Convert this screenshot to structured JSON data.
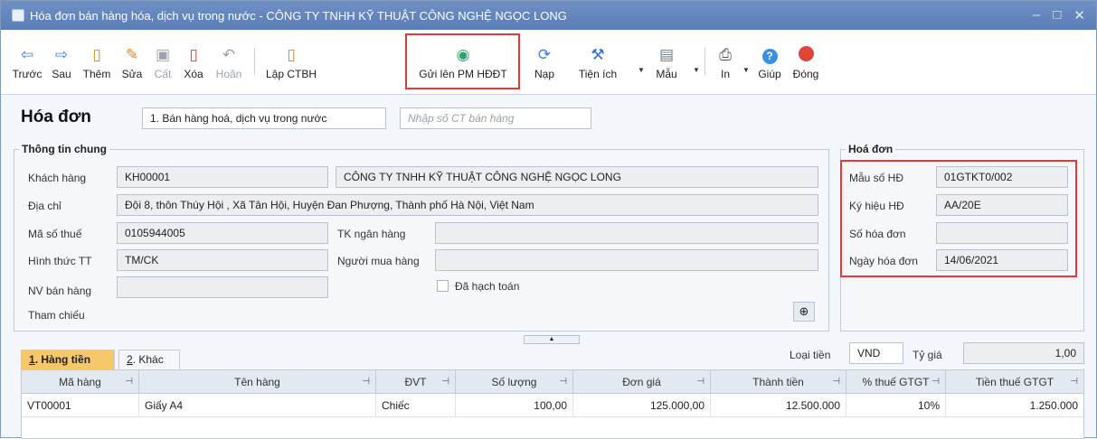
{
  "window": {
    "title": "Hóa đơn bán hàng hóa, dịch vụ trong nước - CÔNG TY TNHH KỸ THUẬT CÔNG NGHỆ NGỌC LONG",
    "controls": [
      "–",
      "□",
      "✕"
    ]
  },
  "toolbar": {
    "items": [
      {
        "label": "Trước",
        "icon": "arrow-left-icon",
        "glyph": "⇦"
      },
      {
        "label": "Sau",
        "icon": "arrow-right-icon",
        "glyph": "⇨"
      },
      {
        "label": "Thêm",
        "icon": "new-document-icon",
        "glyph": "🗋"
      },
      {
        "label": "Sửa",
        "icon": "edit-document-icon",
        "glyph": "✎"
      },
      {
        "label": "Cất",
        "icon": "save-icon",
        "glyph": "💾"
      },
      {
        "label": "Xóa",
        "icon": "delete-document-icon",
        "glyph": "🗑"
      },
      {
        "label": "Hoãn",
        "icon": "undo-icon",
        "glyph": "↶"
      },
      {
        "label": "Lập CTBH",
        "icon": "create-document-icon",
        "glyph": "🗋"
      },
      {
        "label": "Gửi lên PM HĐĐT",
        "icon": "send-globe-icon",
        "glyph": "🌐"
      },
      {
        "label": "Nạp",
        "icon": "reload-icon",
        "glyph": "⟳"
      },
      {
        "label": "Tiện ích",
        "icon": "tools-icon",
        "glyph": "⚒"
      },
      {
        "label": "Mẫu",
        "icon": "template-icon",
        "glyph": "▤"
      },
      {
        "label": "In",
        "icon": "printer-icon",
        "glyph": "🖶"
      },
      {
        "label": "Giúp",
        "icon": "help-icon",
        "glyph": "?"
      },
      {
        "label": "Đóng",
        "icon": "close-circle-icon",
        "glyph": "●"
      }
    ],
    "colors": {
      "nav": "#3b82d8",
      "help": "#3b8fe0",
      "close": "#e0453a",
      "send": "#2ea56a"
    }
  },
  "header": {
    "title": "Hóa đơn",
    "type_value": "1. Bán hàng hoá, dịch vụ trong nước",
    "doc_placeholder": "Nhập số CT bán hàng"
  },
  "general": {
    "group_title": "Thông tin chung",
    "customer_label": "Khách hàng",
    "customer_code": "KH00001",
    "customer_name": "CÔNG TY TNHH KỸ THUẬT CÔNG NGHỆ NGỌC LONG",
    "address_label": "Địa chỉ",
    "address": "Đội 8, thôn Thúy Hội , Xã Tân Hội, Huyện Đan Phượng, Thành phố Hà Nội, Việt Nam",
    "tax_label": "Mã số thuế",
    "tax_code": "0105944005",
    "bank_label": "TK ngân hàng",
    "bank_value": "",
    "payment_label": "Hình thức TT",
    "payment_value": "TM/CK",
    "buyer_label": "Người mua hàng",
    "buyer_value": "",
    "staff_label": "NV bán hàng",
    "staff_value": "",
    "posted_label": "Đã hạch toán",
    "reference_label": "Tham chiếu"
  },
  "invoice": {
    "group_title": "Hoá đơn",
    "form_label": "Mẫu số HĐ",
    "form_value": "01GTKT0/002",
    "symbol_label": "Ký hiệu HĐ",
    "symbol_value": "AA/20E",
    "number_label": "Số hóa đơn",
    "number_value": "",
    "date_label": "Ngày hóa đơn",
    "date_value": "14/06/2021"
  },
  "currency": {
    "label": "Loại tiền",
    "value": "VND",
    "rate_label": "Tỷ giá",
    "rate_value": "1,00"
  },
  "tabs": [
    {
      "label": "1. Hàng tiền",
      "key": "1"
    },
    {
      "label": "2. Khác",
      "key": "2"
    }
  ],
  "grid": {
    "columns": [
      "Mã hàng",
      "Tên hàng",
      "ĐVT",
      "Số lượng",
      "Đơn giá",
      "Thành tiền",
      "% thuế GTGT",
      "Tiền thuế GTGT"
    ],
    "rows": [
      [
        "VT00001",
        "Giấy A4",
        "Chiếc",
        "100,00",
        "125.000,00",
        "12.500.000",
        "10%",
        "1.250.000"
      ]
    ]
  }
}
